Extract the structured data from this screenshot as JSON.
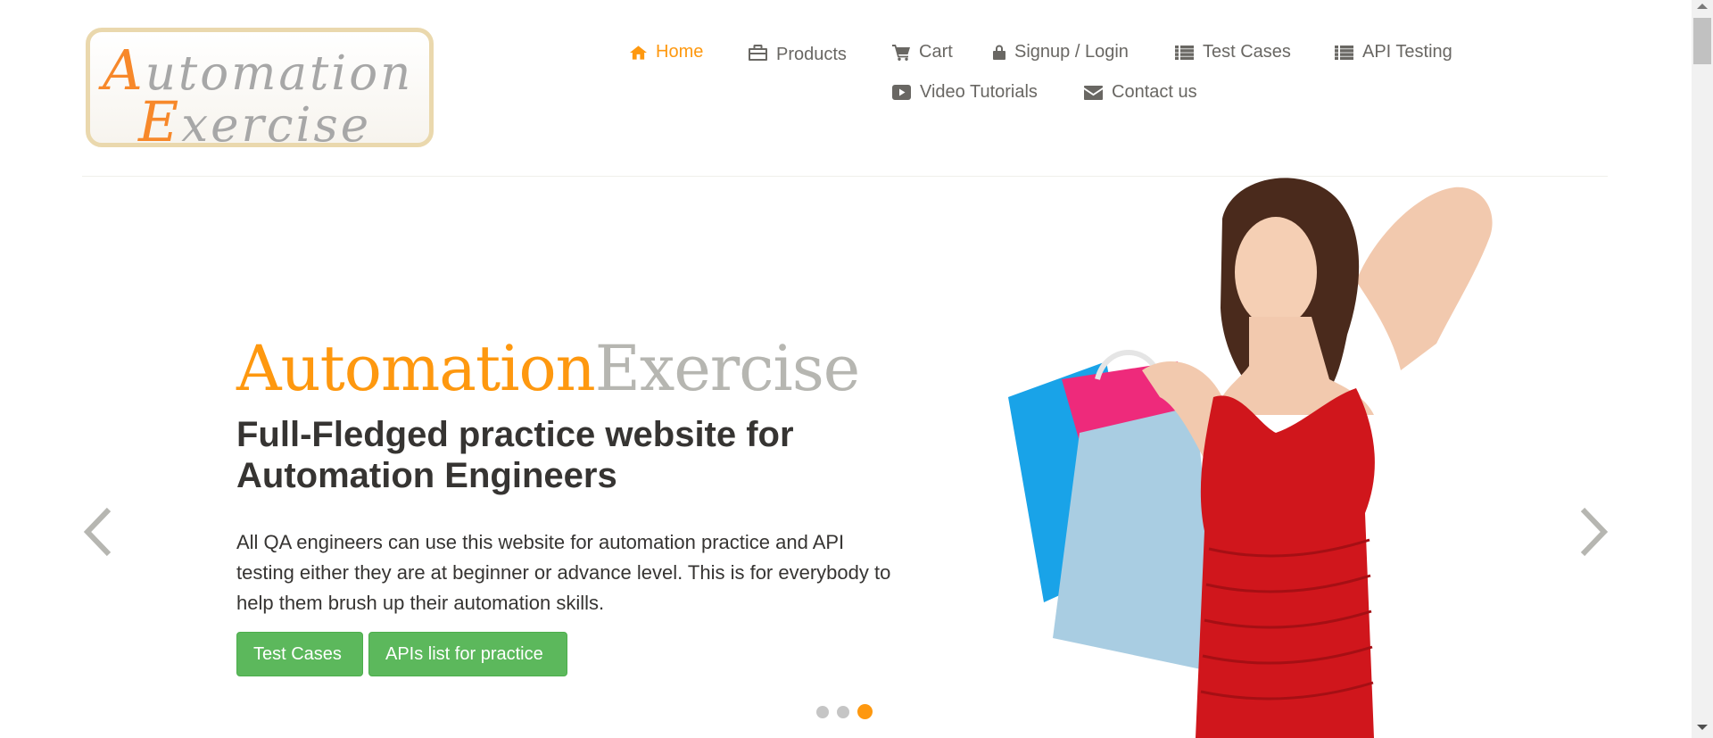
{
  "logo": {
    "line1_first": "A",
    "line1_rest": "utomation",
    "line2_first": "E",
    "line2_rest": "xercise"
  },
  "nav": {
    "home": "Home",
    "products": "Products",
    "cart": "Cart",
    "signup_login": "Signup / Login",
    "test_cases": "Test Cases",
    "api_testing": "API Testing",
    "video_tutorials": "Video Tutorials",
    "contact_us": "Contact us"
  },
  "slider": {
    "brand_part1": "Automation",
    "brand_part2": "Exercise",
    "headline": "Full-Fledged practice website for Automation Engineers",
    "description": "All QA engineers can use this website for automation practice and API testing either they are at beginner or advance level. This is for everybody to help them brush up their automation skills.",
    "button_test_cases": "Test Cases",
    "button_apis": "APIs list for practice",
    "slide_count": 3,
    "active_slide": 3
  },
  "colors": {
    "accent": "#fe980f",
    "nav_text": "#696763",
    "button_green": "#5cb85c",
    "logo_border": "#ead8ad",
    "dress_red": "#d0161c"
  },
  "icons": {
    "home": "home-icon",
    "products": "briefcase-icon",
    "cart": "cart-icon",
    "signup_login": "lock-icon",
    "test_cases": "list-icon",
    "api_testing": "list-icon",
    "video_tutorials": "youtube-play-icon",
    "contact_us": "envelope-icon"
  },
  "hero_image": "woman-with-shopping-bags"
}
